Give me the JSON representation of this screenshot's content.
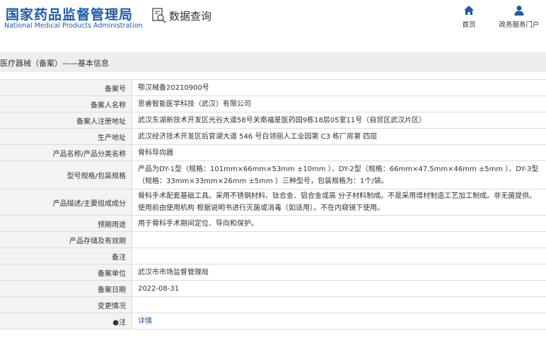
{
  "header": {
    "logo_cn": "国家药品监督管理局",
    "logo_en": "National Medical Products Administration",
    "search_title": "数据查询",
    "nav": [
      {
        "label": "首页",
        "icon": "home-icon"
      },
      {
        "label": "政务服务门户",
        "icon": "user-icon"
      }
    ]
  },
  "breadcrumb": "医疗器械（备案）——基本信息",
  "rows": [
    {
      "label": "备案号",
      "value": "鄂汉械备20210900号"
    },
    {
      "label": "备案人名称",
      "value": "思睿智能医学科技（武汉）有限公司"
    },
    {
      "label": "备案人注册地址",
      "value": "武汉东湖新技术开发区光谷大道58号关南福星医药园9栋18层05室11号（自贸区武汉片区）"
    },
    {
      "label": "生产地址",
      "value": "武汉经济技术开发区后官湖大道 546 号白领丽人工业园第 C3 栋厂房第 四层"
    },
    {
      "label": "产品名称/产品分类名称",
      "value": "骨科导向器"
    },
    {
      "label": "型号规格/包装规格",
      "value": "产品为DY-1型（规格：101mm×66mm×53mm ±10mm ）、DY-2型（规格：66mm×47.5mm×46mm ±5mm ）、DY-3型（规格：33mm×33mm×26mm ±5mm ）三种型号，包装规格为：1个/袋。"
    },
    {
      "label": "产品描述/主要组成成分",
      "value": "骨科手术配套基础工具。采用不锈钢材料、钛合金、铝合金或高 分子材料制成。不是采用增材制造工艺加工制成。非无菌提供。使用前由使用机构 根据说明书进行灭菌或消毒（如适用）。不在内窥镜下使用。"
    },
    {
      "label": "预期用途",
      "value": "用于骨科手术期间定位、导向和保护。"
    },
    {
      "label": "产品存储及有效期",
      "value": ""
    },
    {
      "label": "备注",
      "value": ""
    },
    {
      "label": "备案单位",
      "value": "武汉市市场监督管理局"
    },
    {
      "label": "备案日期",
      "value": "2022-08-31"
    },
    {
      "label": "变更情况",
      "value": ""
    },
    {
      "label": "●注",
      "value": "详情"
    }
  ],
  "colors": {
    "brand_blue": "#1d5ba9",
    "label_bg": "#f3f3f3",
    "crumb_bg": "#eeeeee",
    "border": "#dcdcdc"
  }
}
